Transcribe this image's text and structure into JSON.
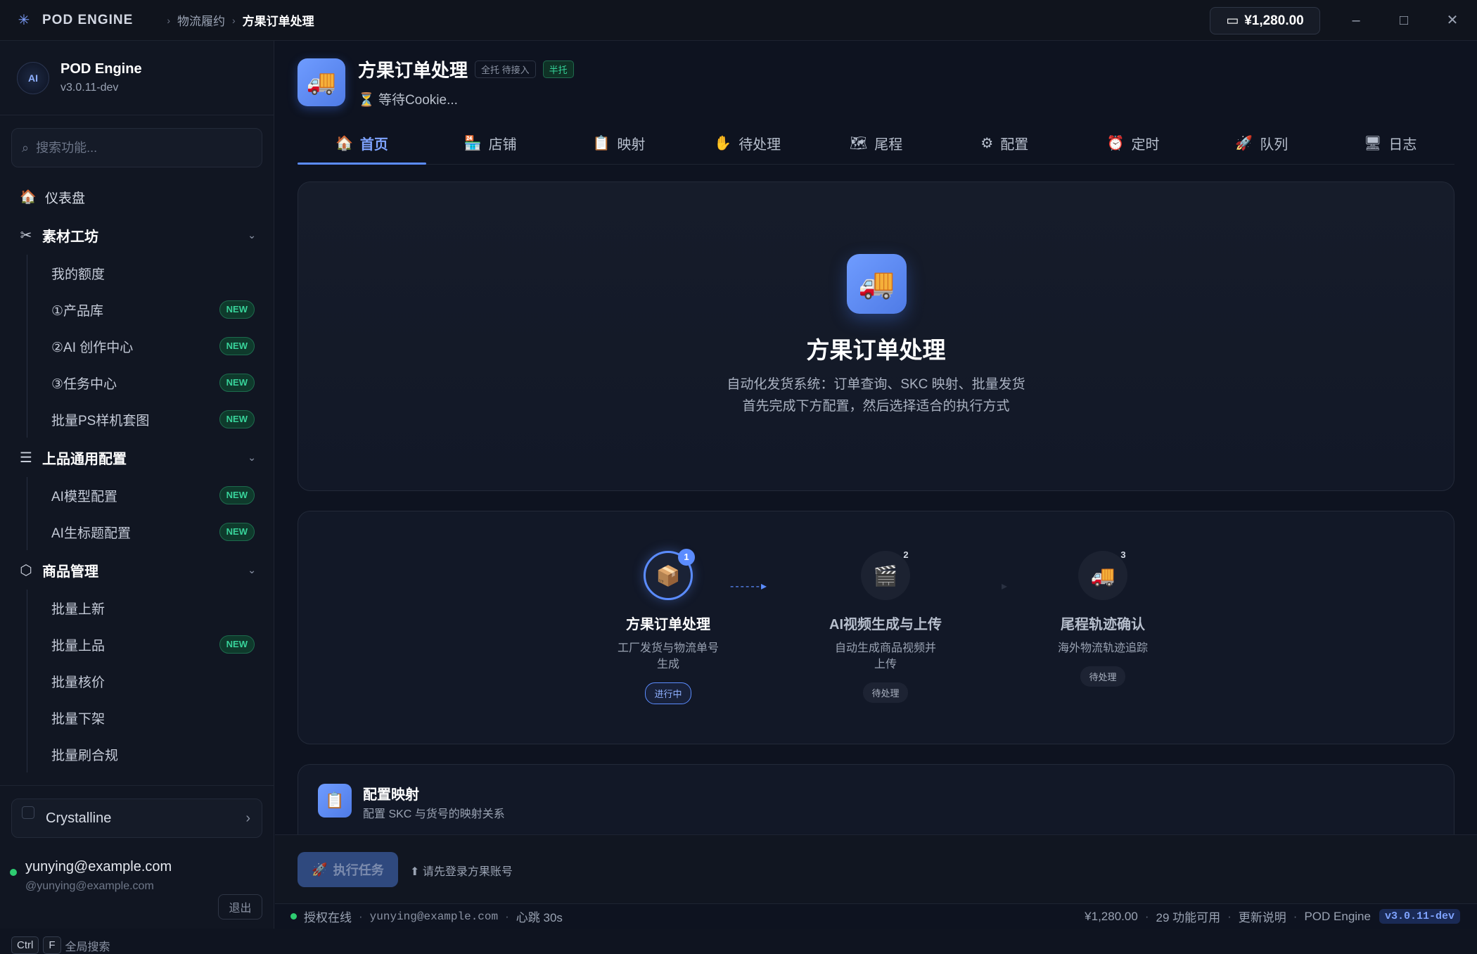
{
  "titlebar": {
    "brand": "POD ENGINE",
    "breadcrumb": [
      "物流履约",
      "方果订单处理"
    ],
    "wallet": "¥1,280.00",
    "window_controls": [
      "minimize-icon",
      "maximize-icon",
      "close-icon"
    ]
  },
  "sidebar": {
    "app_name": "POD Engine",
    "app_version": "v3.0.11-dev",
    "search_placeholder": "搜索功能...",
    "dashboard": "仪表盘",
    "groups": [
      {
        "label": "素材工坊",
        "icon": "scissors-icon",
        "items": [
          {
            "label": "我的额度",
            "badge": ""
          },
          {
            "label": "①产品库",
            "badge": "NEW"
          },
          {
            "label": "②AI 创作中心",
            "badge": "NEW"
          },
          {
            "label": "③任务中心",
            "badge": "NEW"
          },
          {
            "label": "批量PS样机套图",
            "badge": "NEW"
          }
        ]
      },
      {
        "label": "上品通用配置",
        "icon": "sliders-icon",
        "items": [
          {
            "label": "AI模型配置",
            "badge": "NEW"
          },
          {
            "label": "AI生标题配置",
            "badge": "NEW"
          }
        ]
      },
      {
        "label": "商品管理",
        "icon": "box-icon",
        "items": [
          {
            "label": "批量上新",
            "badge": ""
          },
          {
            "label": "批量上品",
            "badge": "NEW"
          },
          {
            "label": "批量核价",
            "badge": ""
          },
          {
            "label": "批量下架",
            "badge": ""
          },
          {
            "label": "批量刷合规",
            "badge": ""
          }
        ]
      }
    ],
    "workspace": "Crystalline",
    "user_email": "yunying@example.com",
    "user_handle": "@yunying@example.com",
    "logout": "退出",
    "shortcut_keys": [
      "Ctrl",
      "F"
    ],
    "shortcut_label": "全局搜索"
  },
  "module": {
    "title": "方果订单处理",
    "tag_a": "全托 待接入",
    "tag_b": "半托",
    "status": "等待Cookie..."
  },
  "tabs": [
    {
      "label": "首页",
      "icon": "🏠",
      "active": true
    },
    {
      "label": "店铺",
      "icon": "🏪",
      "active": false
    },
    {
      "label": "映射",
      "icon": "📋",
      "active": false
    },
    {
      "label": "待处理",
      "icon": "✋",
      "active": false
    },
    {
      "label": "尾程",
      "icon": "🗺",
      "active": false
    },
    {
      "label": "配置",
      "icon": "⚙",
      "active": false
    },
    {
      "label": "定时",
      "icon": "⏰",
      "active": false
    },
    {
      "label": "队列",
      "icon": "🚀",
      "active": false
    },
    {
      "label": "日志",
      "icon": "🖥",
      "active": false
    }
  ],
  "hero": {
    "title": "方果订单处理",
    "desc_line1": "自动化发货系统：订单查询、SKC 映射、批量发货",
    "desc_line2": "首先完成下方配置，然后选择适合的执行方式"
  },
  "steps": [
    {
      "num": "1",
      "icon": "📦",
      "name": "方果订单处理",
      "desc1": "工厂发货与物流单号",
      "desc2": "生成",
      "status": "进行中"
    },
    {
      "num": "2",
      "icon": "🎬",
      "name": "AI视频生成与上传",
      "desc1": "自动生成商品视频并",
      "desc2": "上传",
      "status": "待处理"
    },
    {
      "num": "3",
      "icon": "🚚",
      "name": "尾程轨迹确认",
      "desc1": "海外物流轨迹追踪",
      "desc2": "",
      "status": "待处理"
    }
  ],
  "config_card": {
    "title": "配置映射",
    "desc": "配置 SKC 与货号的映射关系"
  },
  "actionbar": {
    "run_label": "执行任务",
    "hint": "⬆ 请先登录方果账号"
  },
  "statusbar": {
    "auth": "授权在线",
    "email": "yunying@example.com",
    "heartbeat": "心跳 30s",
    "balance": "¥1,280.00",
    "features": "29 功能可用",
    "changelog": "更新说明",
    "product": "POD Engine",
    "version": "v3.0.11-dev"
  }
}
